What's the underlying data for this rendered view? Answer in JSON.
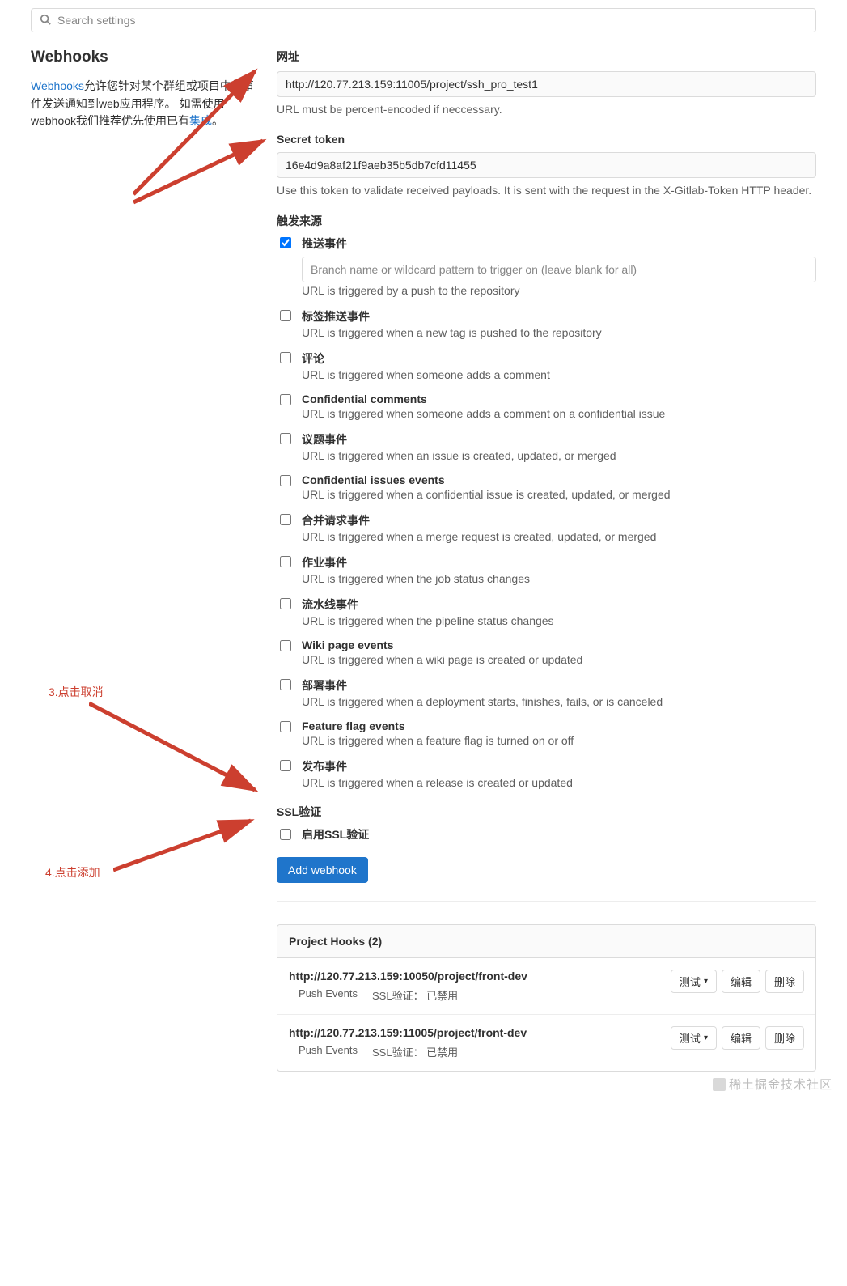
{
  "search": {
    "placeholder": "Search settings"
  },
  "sidebar": {
    "title": "Webhooks",
    "desc_link1": "Webhooks",
    "desc_part1": "允许您针对某个群组或项目中的事件发送通知到web应用程序。 如需使用webhook我们推荐优先使用已有",
    "desc_link2": "集成",
    "desc_part2": "。"
  },
  "form": {
    "url_label": "网址",
    "url_value": "http://120.77.213.159:11005/project/ssh_pro_test1",
    "url_help": "URL must be percent-encoded if neccessary.",
    "token_label": "Secret token",
    "token_value": "16e4d9a8af21f9aeb35b5db7cfd11455",
    "token_help": "Use this token to validate received payloads. It is sent with the request in the X-Gitlab-Token HTTP header.",
    "trigger_label": "触发来源",
    "branch_placeholder": "Branch name or wildcard pattern to trigger on (leave blank for all)",
    "ssl_label": "SSL验证",
    "ssl_checkbox": "启用SSL验证",
    "submit": "Add webhook"
  },
  "triggers": [
    {
      "checked": true,
      "title": "推送事件",
      "help": "URL is triggered by a push to the repository",
      "branch_input": true
    },
    {
      "checked": false,
      "title": "标签推送事件",
      "help": "URL is triggered when a new tag is pushed to the repository"
    },
    {
      "checked": false,
      "title": "评论",
      "help": "URL is triggered when someone adds a comment"
    },
    {
      "checked": false,
      "title": "Confidential comments",
      "help": "URL is triggered when someone adds a comment on a confidential issue"
    },
    {
      "checked": false,
      "title": "议题事件",
      "help": "URL is triggered when an issue is created, updated, or merged"
    },
    {
      "checked": false,
      "title": "Confidential issues events",
      "help": "URL is triggered when a confidential issue is created, updated, or merged"
    },
    {
      "checked": false,
      "title": "合并请求事件",
      "help": "URL is triggered when a merge request is created, updated, or merged"
    },
    {
      "checked": false,
      "title": "作业事件",
      "help": "URL is triggered when the job status changes"
    },
    {
      "checked": false,
      "title": "流水线事件",
      "help": "URL is triggered when the pipeline status changes"
    },
    {
      "checked": false,
      "title": "Wiki page events",
      "help": "URL is triggered when a wiki page is created or updated"
    },
    {
      "checked": false,
      "title": "部署事件",
      "help": "URL is triggered when a deployment starts, finishes, fails, or is canceled"
    },
    {
      "checked": false,
      "title": "Feature flag events",
      "help": "URL is triggered when a feature flag is turned on or off"
    },
    {
      "checked": false,
      "title": "发布事件",
      "help": "URL is triggered when a release is created or updated"
    }
  ],
  "hooks": {
    "header": "Project Hooks (2)",
    "actions": {
      "test": "测试",
      "edit": "编辑",
      "delete": "删除"
    },
    "items": [
      {
        "url": "http://120.77.213.159:10050/project/front-dev",
        "events": "Push Events",
        "ssl": "SSL验证： 已禁用"
      },
      {
        "url": "http://120.77.213.159:11005/project/front-dev",
        "events": "Push Events",
        "ssl": "SSL验证： 已禁用"
      }
    ]
  },
  "annotations": {
    "a3": "3.点击取消",
    "a4": "4.点击添加"
  },
  "watermark": "稀土掘金技术社区"
}
